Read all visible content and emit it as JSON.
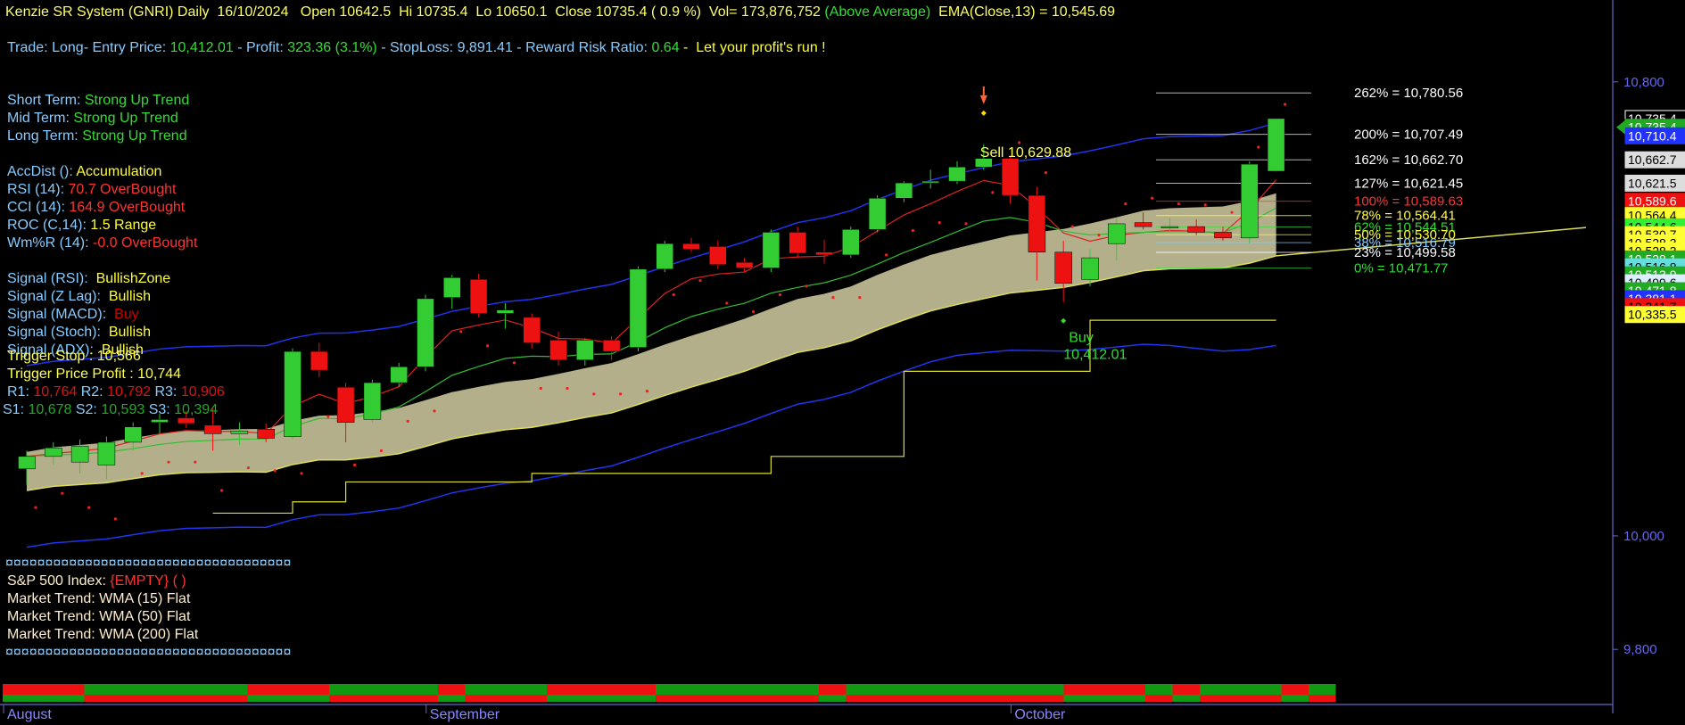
{
  "header": {
    "segments": [
      {
        "text": "Kenzie SR System (GNRI) Daily  16/10/2024   Open 10642.5  Hi 10735.4  Lo 10650.1  Close 10735.4 ( 0.9 %)  Vol= 173,876,752 ",
        "color": "#ffff66"
      },
      {
        "text": "(Above Average)",
        "color": "#33dd33"
      },
      {
        "text": "  EMA(Close,13) = 10,545.69",
        "color": "#ffff66"
      }
    ]
  },
  "trade": {
    "segments": [
      {
        "text": "Trade: Long- Entry Price: ",
        "color": "#88ccff"
      },
      {
        "text": "10,412.01",
        "color": "#33dd33"
      },
      {
        "text": " - Profit: ",
        "color": "#88ccff"
      },
      {
        "text": "323.36 (3.1%)",
        "color": "#33dd33"
      },
      {
        "text": " - StopLoss: 9,891.41 - Reward Risk Ratio: ",
        "color": "#88ccff"
      },
      {
        "text": "0.64",
        "color": "#33dd33"
      },
      {
        "text": " -  Let your profit's run !",
        "color": "#ffff33"
      }
    ]
  },
  "trend_labels": [
    {
      "label": "Short Term: ",
      "value": "Strong Up Trend",
      "vcolor": "#33dd33"
    },
    {
      "label": "Mid Term: ",
      "value": "Strong Up Trend",
      "vcolor": "#33dd33"
    },
    {
      "label": "Long Term: ",
      "value": "Strong Up Trend",
      "vcolor": "#33dd33"
    }
  ],
  "indicators": [
    {
      "label": "AccDist (): ",
      "value": "Accumulation",
      "vcolor": "#ffff33"
    },
    {
      "label": "RSI (14): ",
      "value": "70.7 OverBought",
      "vcolor": "#ff3333"
    },
    {
      "label": "CCI (14): ",
      "value": "164.9 OverBought",
      "vcolor": "#ff3333"
    },
    {
      "label": "ROC (C,14): ",
      "value": "1.5 Range",
      "vcolor": "#ffff33"
    },
    {
      "label": "Wm%R (14): ",
      "value": "-0.0 OverBought",
      "vcolor": "#ff3333"
    }
  ],
  "signals": [
    {
      "label": "Signal (RSI):  ",
      "value": "BullishZone",
      "vcolor": "#ffff33"
    },
    {
      "label": "Signal (Z Lag):  ",
      "value": "Bullish",
      "vcolor": "#ffff33"
    },
    {
      "label": "Signal (MACD):  ",
      "value": "Buy",
      "vcolor": "#cc0000"
    },
    {
      "label": "Signal (Stoch):  ",
      "value": "Bullish",
      "vcolor": "#ffff33"
    },
    {
      "label": "Signal (ADX):  ",
      "value": "Bullish",
      "vcolor": "#ffff33"
    }
  ],
  "trigger": {
    "stop": "Trigger Stop : 10,566",
    "profit": "Trigger Price Profit : 10,744"
  },
  "resistance": [
    {
      "label": "R1: ",
      "value": "10,764"
    },
    {
      "label": " R2: ",
      "value": "10,792"
    },
    {
      "label": " R3: ",
      "value": "10,906"
    }
  ],
  "support": [
    {
      "label": "S1: ",
      "value": "10,678"
    },
    {
      "label": " S2: ",
      "value": "10,593"
    },
    {
      "label": " S3: ",
      "value": "10,394"
    }
  ],
  "market": {
    "separator": "¤¤¤¤¤¤¤¤¤¤¤¤¤¤¤¤¤¤¤¤¤¤¤¤¤¤¤¤¤¤¤¤¤¤¤¤",
    "sp500_label": "S&P 500 Index: ",
    "sp500_value": "{EMPTY} ( )",
    "trends": [
      "Market Trend: WMA (15) Flat",
      "Market Trend: WMA (50) Flat",
      "Market Trend: WMA (200) Flat"
    ]
  },
  "annotations": {
    "sell_label": "Sell  10,629.88",
    "buy_label": "Buy",
    "buy_price": "10,412.01"
  },
  "chart_data": {
    "type": "candlestick",
    "y_axis": {
      "min": 9750,
      "max": 10850,
      "ticks": [
        "10,800",
        "10,000",
        "9,800"
      ],
      "tick_values": [
        10800,
        10000,
        9800
      ]
    },
    "x_axis": {
      "labels": [
        "August",
        "September",
        "October"
      ],
      "label_indices": [
        0,
        16,
        38
      ]
    },
    "candles": [
      {
        "o": 10118,
        "h": 10150,
        "l": 10090,
        "c": 10140
      },
      {
        "o": 10140,
        "h": 10165,
        "l": 10125,
        "c": 10155
      },
      {
        "o": 10130,
        "h": 10170,
        "l": 10110,
        "c": 10158
      },
      {
        "o": 10125,
        "h": 10175,
        "l": 10100,
        "c": 10165
      },
      {
        "o": 10165,
        "h": 10200,
        "l": 10150,
        "c": 10192
      },
      {
        "o": 10200,
        "h": 10215,
        "l": 10180,
        "c": 10205
      },
      {
        "o": 10208,
        "h": 10220,
        "l": 10190,
        "c": 10198
      },
      {
        "o": 10195,
        "h": 10225,
        "l": 10150,
        "c": 10180
      },
      {
        "o": 10180,
        "h": 10200,
        "l": 10160,
        "c": 10185
      },
      {
        "o": 10188,
        "h": 10198,
        "l": 10165,
        "c": 10172
      },
      {
        "o": 10175,
        "h": 10330,
        "l": 10170,
        "c": 10325
      },
      {
        "o": 10325,
        "h": 10340,
        "l": 10280,
        "c": 10292
      },
      {
        "o": 10262,
        "h": 10270,
        "l": 10165,
        "c": 10200
      },
      {
        "o": 10205,
        "h": 10275,
        "l": 10200,
        "c": 10270
      },
      {
        "o": 10270,
        "h": 10305,
        "l": 10262,
        "c": 10298
      },
      {
        "o": 10298,
        "h": 10425,
        "l": 10290,
        "c": 10418
      },
      {
        "o": 10420,
        "h": 10460,
        "l": 10400,
        "c": 10455
      },
      {
        "o": 10452,
        "h": 10462,
        "l": 10385,
        "c": 10392
      },
      {
        "o": 10392,
        "h": 10410,
        "l": 10365,
        "c": 10398
      },
      {
        "o": 10385,
        "h": 10392,
        "l": 10330,
        "c": 10340
      },
      {
        "o": 10345,
        "h": 10360,
        "l": 10300,
        "c": 10310
      },
      {
        "o": 10310,
        "h": 10348,
        "l": 10300,
        "c": 10345
      },
      {
        "o": 10345,
        "h": 10352,
        "l": 10310,
        "c": 10325
      },
      {
        "o": 10332,
        "h": 10475,
        "l": 10325,
        "c": 10470
      },
      {
        "o": 10470,
        "h": 10520,
        "l": 10465,
        "c": 10515
      },
      {
        "o": 10515,
        "h": 10525,
        "l": 10500,
        "c": 10505
      },
      {
        "o": 10510,
        "h": 10520,
        "l": 10470,
        "c": 10478
      },
      {
        "o": 10482,
        "h": 10490,
        "l": 10465,
        "c": 10472
      },
      {
        "o": 10472,
        "h": 10540,
        "l": 10465,
        "c": 10535
      },
      {
        "o": 10535,
        "h": 10545,
        "l": 10490,
        "c": 10498
      },
      {
        "o": 10500,
        "h": 10522,
        "l": 10480,
        "c": 10495
      },
      {
        "o": 10495,
        "h": 10545,
        "l": 10490,
        "c": 10540
      },
      {
        "o": 10540,
        "h": 10600,
        "l": 10535,
        "c": 10595
      },
      {
        "o": 10595,
        "h": 10625,
        "l": 10588,
        "c": 10622
      },
      {
        "o": 10622,
        "h": 10645,
        "l": 10612,
        "c": 10625
      },
      {
        "o": 10625,
        "h": 10660,
        "l": 10620,
        "c": 10650
      },
      {
        "o": 10650,
        "h": 10690,
        "l": 10645,
        "c": 10665
      },
      {
        "o": 10665,
        "h": 10668,
        "l": 10585,
        "c": 10600
      },
      {
        "o": 10600,
        "h": 10615,
        "l": 10450,
        "c": 10500
      },
      {
        "o": 10500,
        "h": 10520,
        "l": 10412,
        "c": 10445
      },
      {
        "o": 10452,
        "h": 10505,
        "l": 10440,
        "c": 10490
      },
      {
        "o": 10515,
        "h": 10560,
        "l": 10485,
        "c": 10550
      },
      {
        "o": 10552,
        "h": 10570,
        "l": 10540,
        "c": 10545
      },
      {
        "o": 10545,
        "h": 10560,
        "l": 10535,
        "c": 10545
      },
      {
        "o": 10545,
        "h": 10558,
        "l": 10530,
        "c": 10535
      },
      {
        "o": 10535,
        "h": 10545,
        "l": 10520,
        "c": 10525
      },
      {
        "o": 10525,
        "h": 10660,
        "l": 10515,
        "c": 10655
      },
      {
        "o": 10642.5,
        "h": 10735.4,
        "l": 10650.1,
        "c": 10735.4
      }
    ],
    "fib_levels": [
      {
        "label": "262% = 10,780.56",
        "value": 10780.56,
        "color": "#ffffff"
      },
      {
        "label": "200% = 10,707.49",
        "value": 10707.49,
        "color": "#ffffff"
      },
      {
        "label": "162% = 10,662.70",
        "value": 10662.7,
        "color": "#ffffff"
      },
      {
        "label": "127% = 10,621.45",
        "value": 10621.45,
        "color": "#ffffff"
      },
      {
        "label": "100% = 10,589.63",
        "value": 10589.63,
        "color": "#ff3333"
      },
      {
        "label": "78% = 10,564.41",
        "value": 10564.41,
        "color": "#ffff33"
      },
      {
        "label": "62% = 10,544.51",
        "value": 10544.51,
        "color": "#33dd33"
      },
      {
        "label": "50% = 10,530.70",
        "value": 10530.7,
        "color": "#ffff33"
      },
      {
        "label": "38% = 10,516.79",
        "value": 10516.79,
        "color": "#88ccff"
      },
      {
        "label": "23% = 10,499.58",
        "value": 10499.58,
        "color": "#ffffff"
      },
      {
        "label": "0% = 10,471.77",
        "value": 10471.77,
        "color": "#33dd33"
      }
    ],
    "price_tags": [
      {
        "text": "10,735.4",
        "value": 10735.4,
        "bg": "#000000",
        "fg": "#ffffff",
        "border": "#ffffff"
      },
      {
        "text": "10,735.4",
        "value": 10720,
        "bg": "#22aa22",
        "fg": "#ffffff",
        "border": "#22aa22"
      },
      {
        "text": "10,710.4",
        "value": 10705,
        "bg": "#2233ff",
        "fg": "#ffffff",
        "border": "#2233ff"
      },
      {
        "text": "10,662.7",
        "value": 10662.7,
        "bg": "#dddddd",
        "fg": "#000000",
        "border": "#dddddd"
      },
      {
        "text": "10,621.5",
        "value": 10621.5,
        "bg": "#dddddd",
        "fg": "#000000",
        "border": "#dddddd"
      },
      {
        "text": "10,589.6",
        "value": 10589.6,
        "bg": "#ee1111",
        "fg": "#ffffff",
        "border": "#ee1111"
      },
      {
        "text": "10,564.4",
        "value": 10564.4,
        "bg": "#ffff33",
        "fg": "#000000",
        "border": "#ffff33"
      },
      {
        "text": "10,544.6",
        "value": 10544.6,
        "bg": "#33ee33",
        "fg": "#000000",
        "border": "#33ee33"
      },
      {
        "text": "10,530.7",
        "value": 10530.7,
        "bg": "#ffff33",
        "fg": "#000000",
        "border": "#ffff33"
      },
      {
        "text": "10,528.3",
        "value": 10516.0,
        "bg": "#ffff33",
        "fg": "#000000",
        "border": "#ffff33"
      },
      {
        "text": "10,528.3",
        "value": 10502.0,
        "bg": "#ffff33",
        "fg": "#000000",
        "border": "#ffff33"
      },
      {
        "text": "10,528.1",
        "value": 10488.0,
        "bg": "#22aa22",
        "fg": "#ffffff",
        "border": "#22aa22"
      },
      {
        "text": "10,516.8",
        "value": 10474.0,
        "bg": "#66dddd",
        "fg": "#000000",
        "border": "#66dddd"
      },
      {
        "text": "10,513.9",
        "value": 10460.0,
        "bg": "#22aa22",
        "fg": "#ffffff",
        "border": "#22aa22"
      },
      {
        "text": "10,499.6",
        "value": 10446.0,
        "bg": "#ddeeff",
        "fg": "#000000",
        "border": "#ddeeff"
      },
      {
        "text": "10,471.8",
        "value": 10432.0,
        "bg": "#22aa22",
        "fg": "#ffffff",
        "border": "#22aa22"
      },
      {
        "text": "10,381.1",
        "value": 10418.0,
        "bg": "#2233ff",
        "fg": "#ffffff",
        "border": "#2233ff"
      },
      {
        "text": "10,341.7",
        "value": 10404.0,
        "bg": "#ee1111",
        "fg": "#000000",
        "border": "#ee1111"
      },
      {
        "text": "10,335.5",
        "value": 10390.0,
        "bg": "#ffff33",
        "fg": "#000000",
        "border": "#ffff33"
      }
    ],
    "trend_bar": [
      "r",
      "r",
      "r",
      "g",
      "g",
      "g",
      "g",
      "g",
      "g",
      "r",
      "r",
      "r",
      "g",
      "g",
      "g",
      "g",
      "r",
      "g",
      "g",
      "g",
      "r",
      "r",
      "r",
      "r",
      "g",
      "g",
      "g",
      "g",
      "g",
      "g",
      "r",
      "g",
      "g",
      "g",
      "g",
      "g",
      "g",
      "g",
      "g",
      "r",
      "r",
      "r",
      "g",
      "r",
      "g",
      "g",
      "g",
      "r",
      "g"
    ]
  }
}
